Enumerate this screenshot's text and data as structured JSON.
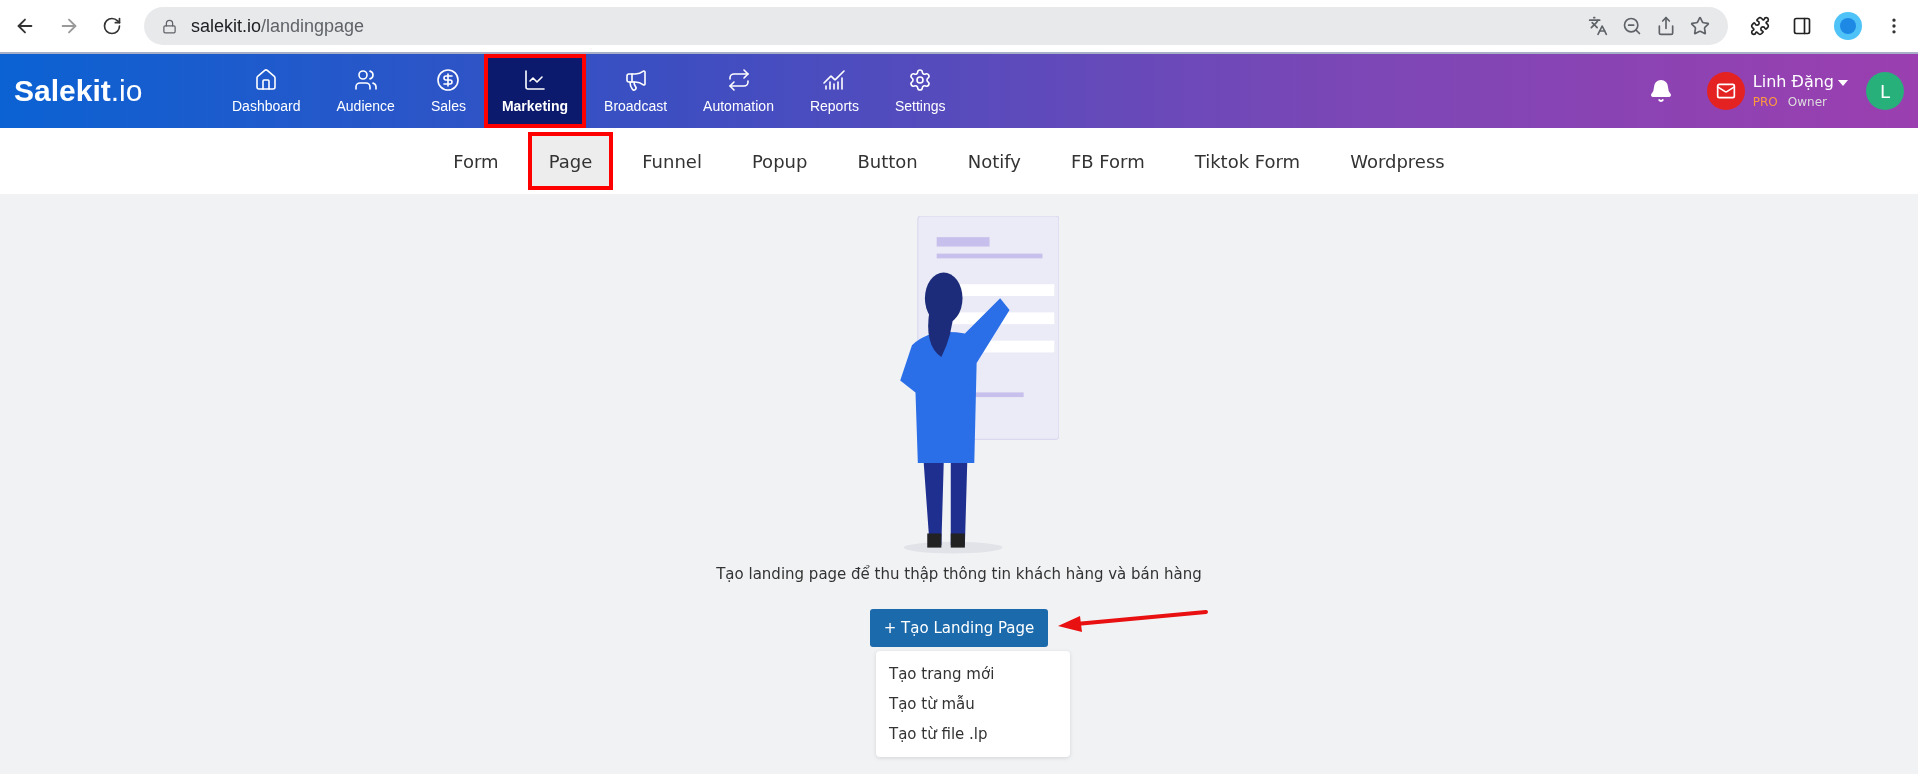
{
  "browser": {
    "url_host": "salekit.io",
    "url_path": "/landingpage"
  },
  "nav": {
    "logo_main": "Salekit",
    "logo_suffix": ".io",
    "items": [
      {
        "label": "Dashboard",
        "selected": false,
        "annotated": false
      },
      {
        "label": "Audience",
        "selected": false,
        "annotated": false
      },
      {
        "label": "Sales",
        "selected": false,
        "annotated": false
      },
      {
        "label": "Marketing",
        "selected": true,
        "annotated": true
      },
      {
        "label": "Broadcast",
        "selected": false,
        "annotated": false
      },
      {
        "label": "Automation",
        "selected": false,
        "annotated": false
      },
      {
        "label": "Reports",
        "selected": false,
        "annotated": false
      },
      {
        "label": "Settings",
        "selected": false,
        "annotated": false
      }
    ],
    "user": {
      "name": "Linh Đặng",
      "plan": "PRO",
      "role": "Owner",
      "avatar_letter": "L"
    }
  },
  "subnav": [
    {
      "label": "Form",
      "selected": false,
      "annotated": false
    },
    {
      "label": "Page",
      "selected": true,
      "annotated": true
    },
    {
      "label": "Funnel",
      "selected": false,
      "annotated": false
    },
    {
      "label": "Popup",
      "selected": false,
      "annotated": false
    },
    {
      "label": "Button",
      "selected": false,
      "annotated": false
    },
    {
      "label": "Notify",
      "selected": false,
      "annotated": false
    },
    {
      "label": "FB Form",
      "selected": false,
      "annotated": false
    },
    {
      "label": "Tiktok Form",
      "selected": false,
      "annotated": false
    },
    {
      "label": "Wordpress",
      "selected": false,
      "annotated": false
    }
  ],
  "empty_state": {
    "message": "Tạo landing page để thu thập thông tin khách hàng và bán hàng",
    "button": "+ Tạo Landing Page",
    "menu": [
      "Tạo trang mới",
      "Tạo từ mẫu",
      "Tạo từ file .lp"
    ]
  }
}
